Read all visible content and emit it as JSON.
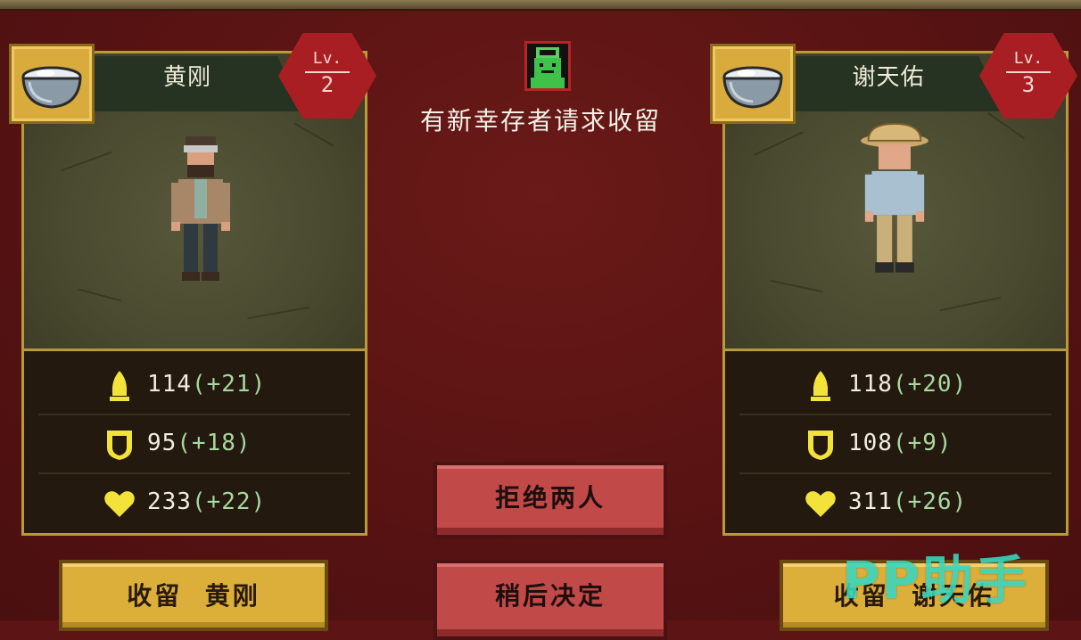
{
  "request_title": "有新幸存者请求收留",
  "survivors": [
    {
      "name": "黄刚",
      "level_label": "Lv.",
      "level": "2",
      "stats": {
        "attack": "114",
        "attack_bonus": "(+21)",
        "defense": "95",
        "defense_bonus": "(+18)",
        "health": "233",
        "health_bonus": "(+22)"
      },
      "accept_label": "收留  黄刚"
    },
    {
      "name": "谢天佑",
      "level_label": "Lv.",
      "level": "3",
      "stats": {
        "attack": "118",
        "attack_bonus": "(+20)",
        "defense": "108",
        "defense_bonus": "(+9)",
        "health": "311",
        "health_bonus": "(+26)"
      },
      "accept_label": "收留  谢天佑"
    }
  ],
  "buttons": {
    "reject_both": "拒绝两人",
    "decide_later": "稍后决定"
  },
  "watermark": "PP助手",
  "icons": {
    "portrait_badge": "rice-bowl-icon",
    "attack": "bullet-icon",
    "defense": "shield-icon",
    "health": "heart-icon",
    "request_avatar": "survivor-face-icon"
  },
  "colors": {
    "background": "#5c1414",
    "card_border": "#b89a38",
    "stat_icon": "#f2e23a",
    "level_badge": "#a81e22",
    "accept_button": "#dcae3a",
    "action_button": "#c14a48"
  }
}
